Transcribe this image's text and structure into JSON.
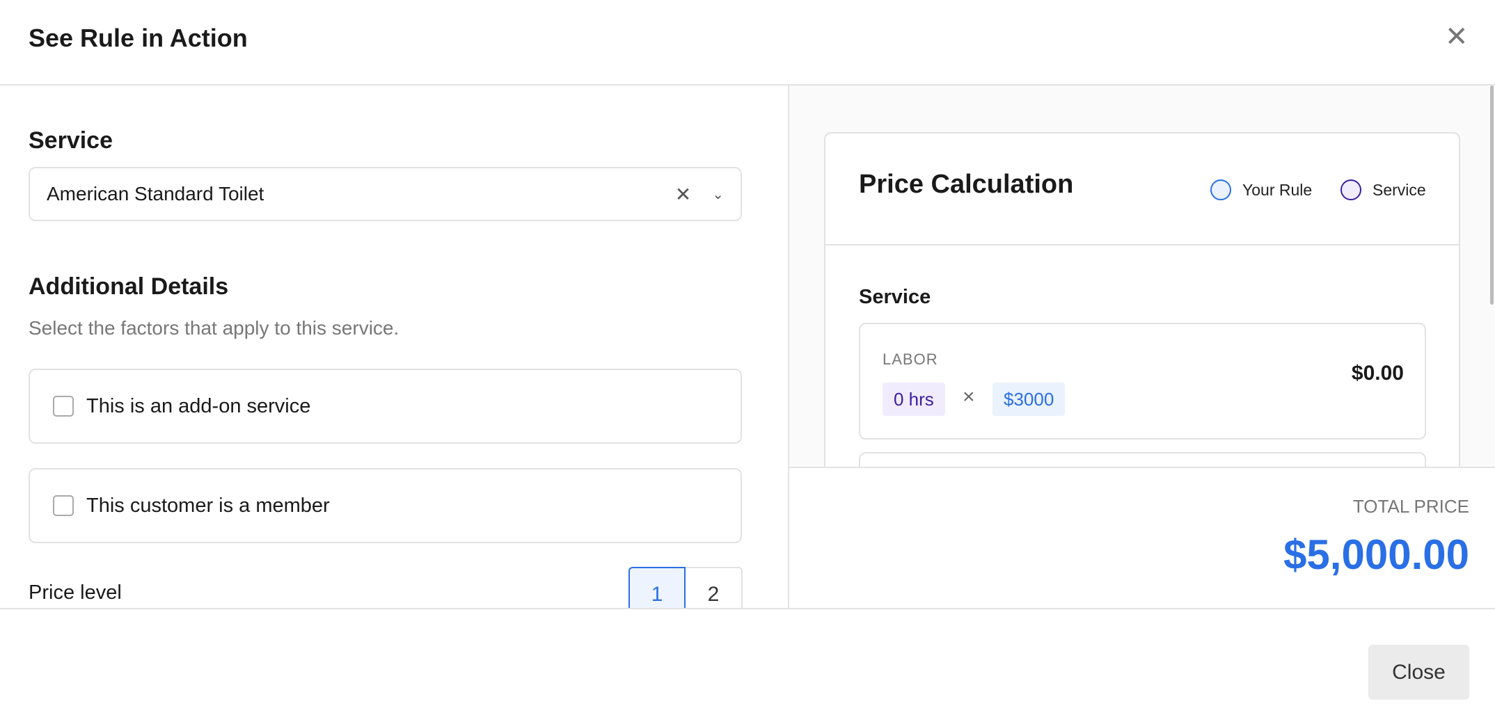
{
  "modal": {
    "title": "See Rule in Action",
    "close_icon": "close-icon"
  },
  "left": {
    "service_label": "Service",
    "service_value": "American Standard Toilet",
    "additional_title": "Additional Details",
    "additional_sub": "Select the factors that apply to this service.",
    "options": [
      {
        "label": "This is an add-on service",
        "checked": false
      },
      {
        "label": "This customer is a member",
        "checked": false
      }
    ],
    "price_level_label": "Price level",
    "price_levels": [
      "1",
      "2"
    ],
    "price_level_selected": "1"
  },
  "right": {
    "title": "Price Calculation",
    "legend": [
      {
        "label": "Your Rule",
        "color": "#2a6fe5"
      },
      {
        "label": "Service",
        "color": "#3a1fa0"
      }
    ],
    "section": "Service",
    "labor": {
      "label": "LABOR",
      "hours": "0 hrs",
      "times": "×",
      "rate": "$3000",
      "amount": "$0.00"
    },
    "total_label": "TOTAL PRICE",
    "total_value": "$5,000.00"
  },
  "footer": {
    "close": "Close"
  }
}
